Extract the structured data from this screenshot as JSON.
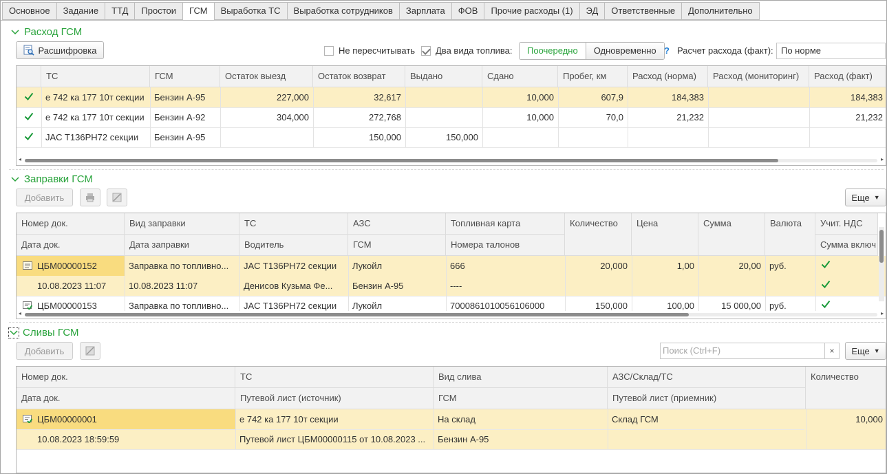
{
  "tabs": [
    "Основное",
    "Задание",
    "ТТД",
    "Простои",
    "ГСМ",
    "Выработка ТС",
    "Выработка сотрудников",
    "Зарплата",
    "ФОВ",
    "Прочие расходы (1)",
    "ЭД",
    "Ответственные",
    "Дополнительно"
  ],
  "active_tab": "ГСМ",
  "fuel_usage": {
    "title": "Расход ГСМ",
    "decode_button": "Расшифровка",
    "no_recalc_label": "Не пересчитывать",
    "no_recalc_checked": false,
    "two_fuel_label": "Два вида топлива:",
    "two_fuel_checked": true,
    "mode_options": [
      "Поочередно",
      "Одновременно"
    ],
    "mode_selected": "Поочередно",
    "help": "?",
    "fact_calc_label": "Расчет расхода (факт):",
    "fact_calc_value": "По норме",
    "columns": [
      "ТС",
      "ГСМ",
      "Остаток выезд",
      "Остаток возврат",
      "Выдано",
      "Сдано",
      "Пробег, км",
      "Расход (норма)",
      "Расход (мониторинг)",
      "Расход (факт)"
    ],
    "rows": [
      {
        "checked": true,
        "vehicle": "е 742 ка 177 10т секции",
        "fuel": "Бензин А-95",
        "rest_out": "227,000",
        "rest_back": "32,617",
        "issued": "",
        "handed": "10,000",
        "mileage": "607,9",
        "norm": "184,383",
        "monitoring": "",
        "fact": "184,383"
      },
      {
        "checked": true,
        "vehicle": "е 742 ка 177 10т секции",
        "fuel": "Бензин А-92",
        "rest_out": "304,000",
        "rest_back": "272,768",
        "issued": "",
        "handed": "10,000",
        "mileage": "70,0",
        "norm": "21,232",
        "monitoring": "",
        "fact": "21,232"
      },
      {
        "checked": true,
        "vehicle": "JAC T136PH72 секции",
        "fuel": "Бензин А-95",
        "rest_out": "",
        "rest_back": "150,000",
        "issued": "150,000",
        "handed": "",
        "mileage": "",
        "norm": "",
        "monitoring": "",
        "fact": ""
      }
    ]
  },
  "refuels": {
    "title": "Заправки ГСМ",
    "add_button": "Добавить",
    "more_button": "Еще",
    "header_top": [
      "Номер док.",
      "Вид заправки",
      "ТС",
      "АЗС",
      "Топливная карта",
      "Количество",
      "Цена",
      "Сумма",
      "Валюта",
      "Учит. НДС"
    ],
    "header_bottom": [
      "Дата док.",
      "Дата заправки",
      "Водитель",
      "ГСМ",
      "Номера талонов",
      "Сумма включ"
    ],
    "rows": [
      {
        "doc_no": "ЦБМ00000152",
        "kind": "Заправка по топливно...",
        "vehicle": "JAC T136PH72 секции",
        "station": "Лукойл",
        "card": "666",
        "qty": "20,000",
        "price": "1,00",
        "sum": "20,00",
        "currency": "руб.",
        "vat": true,
        "doc_date": "10.08.2023 11:07",
        "refuel_date": "10.08.2023 11:07",
        "driver": "Денисов Кузьма Фе...",
        "fuel": "Бензин А-95",
        "coupons": "----",
        "vat_included": true
      },
      {
        "doc_no": "ЦБМ00000153",
        "kind": "Заправка по топливно...",
        "vehicle": "JAC T136PH72 секции",
        "station": "Лукойл",
        "card": "7000861010056106000",
        "qty": "150,000",
        "price": "100,00",
        "sum": "15 000,00",
        "currency": "руб.",
        "vat": true
      }
    ]
  },
  "drains": {
    "title": "Сливы ГСМ",
    "add_button": "Добавить",
    "search_placeholder": "Поиск (Ctrl+F)",
    "clear": "×",
    "more_button": "Еще",
    "header_top": [
      "Номер док.",
      "ТС",
      "Вид слива",
      "АЗС/Склад/ТС",
      "Количество"
    ],
    "header_bottom": [
      "Дата док.",
      "Путевой лист (источник)",
      "ГСМ",
      "Путевой лист (приемник)"
    ],
    "rows": [
      {
        "doc_no": "ЦБМ00000001",
        "vehicle": "е 742 ка 177 10т секции",
        "kind": "На склад",
        "target": "Склад ГСМ",
        "qty": "10,000",
        "doc_date": "10.08.2023 18:59:59",
        "source_sheet": "Путевой лист ЦБМ00000115 от 10.08.2023 ...",
        "fuel": "Бензин А-95",
        "target_sheet": ""
      }
    ]
  },
  "colors": {
    "accent": "#28a33b",
    "selected_row": "#fcefc4",
    "check": "#1b9a3a",
    "help": "#1f7fd6"
  }
}
